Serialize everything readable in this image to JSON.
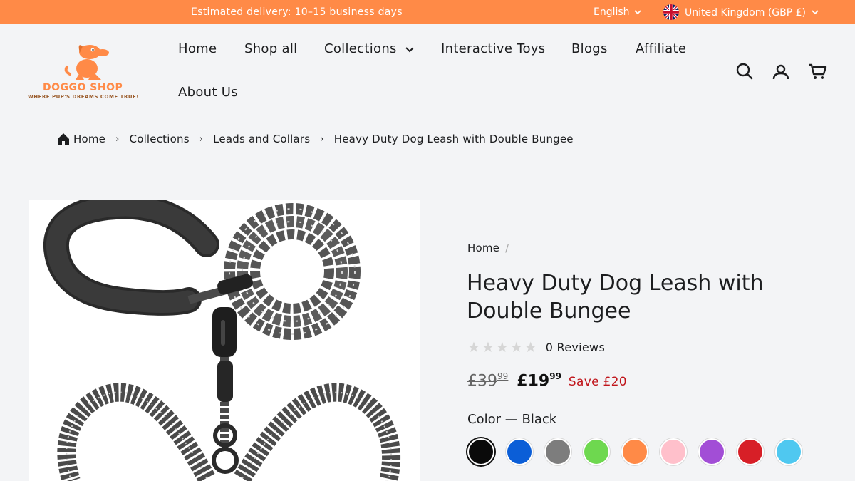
{
  "topbar": {
    "delivery": "Estimated delivery: 10–15 business days",
    "language": "English",
    "country": "United Kingdom (GBP £)"
  },
  "logo": {
    "name": "DOGGO SHOP",
    "tagline": "WHERE PUP'S DREAMS COME TRUE!"
  },
  "nav": {
    "items": [
      "Home",
      "Shop all",
      "Collections",
      "Interactive Toys",
      "Blogs",
      "Affiliate",
      "About Us"
    ]
  },
  "header_icons": [
    "search-icon",
    "account-icon",
    "cart-icon"
  ],
  "breadcrumb": [
    "Home",
    "Collections",
    "Leads and Collars",
    "Heavy Duty Dog Leash with Double Bungee"
  ],
  "product": {
    "mini_breadcrumb": "Home",
    "mini_separator": "/",
    "title": "Heavy Duty Dog Leash with Double Bungee",
    "review_stars": 0,
    "reviews": "0 Reviews",
    "old_price": "£39",
    "old_price_cents": "99",
    "price": "£19",
    "price_cents": "99",
    "save": "Save £20",
    "color_label": "Color",
    "color_dash": "—",
    "color_value": "Black",
    "swatches": [
      "#0a0a0a",
      "#0b5ed7",
      "#7d7d7d",
      "#6ed84f",
      "#ff8a47",
      "#ffc0cb",
      "#a24ed6",
      "#d71f27",
      "#4fc8f0"
    ]
  },
  "colors": {
    "accent": "#ff8a47",
    "background": "#f3f4f6",
    "sale_red": "#c0141a"
  }
}
